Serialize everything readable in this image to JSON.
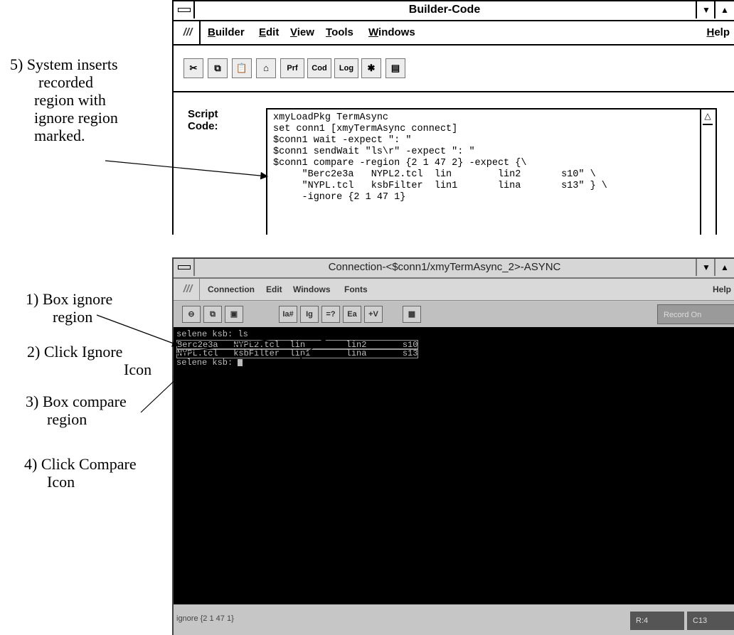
{
  "annotations": {
    "step5": [
      "5) System inserts",
      "recorded",
      "region with",
      "ignore region",
      "marked."
    ],
    "step1": [
      "1) Box ignore",
      "region"
    ],
    "step2": [
      "2) Click Ignore",
      "Icon"
    ],
    "step3": [
      "3) Box compare",
      "region"
    ],
    "step4": [
      "4) Click Compare",
      "Icon"
    ]
  },
  "builder_window": {
    "title": "Builder-Code",
    "menu": [
      "Builder",
      "Edit",
      "View",
      "Tools",
      "Windows"
    ],
    "help": "Help",
    "toolbar_text_buttons": [
      "Prf",
      "Cod",
      "Log"
    ],
    "script_label_1": "Script",
    "script_label_2": "Code:",
    "code_lines": [
      "xmyLoadPkg TermAsync",
      "set conn1 [xmyTermAsync connect]",
      "$conn1 wait -expect \": \"",
      "$conn1 sendWait \"ls\\r\" -expect \": \"",
      "$conn1 compare -region {2 1 47 2} -expect {\\",
      "     \"Berc2e3a   NYPL2.tcl  lin        lin2       s10\" \\",
      "     \"NYPL.tcl   ksbFilter  lin1       lina       s13\" } \\",
      "     -ignore {2 1 47 1}"
    ]
  },
  "connection_window": {
    "title": "Connection-<$conn1/xmyTermAsync_2>-ASYNC",
    "menu": [
      "Connection",
      "Edit",
      "Windows",
      "Fonts"
    ],
    "help": "Help",
    "toolbar_text_buttons": [
      "Ia#",
      "Ig",
      "=?",
      "Ea",
      "+V"
    ],
    "record_label": "Record On",
    "terminal_lines": [
      "selene ksb: ls",
      "Berc2e3a   NYPL2.tcl  lin        lin2       s10",
      "NYPL.tcl   ksbFilter  lin1       lina       s13",
      "selene ksb: "
    ],
    "status_left": "ignore {2 1 47 1}",
    "status_row": "R:4",
    "status_col": "C13"
  }
}
